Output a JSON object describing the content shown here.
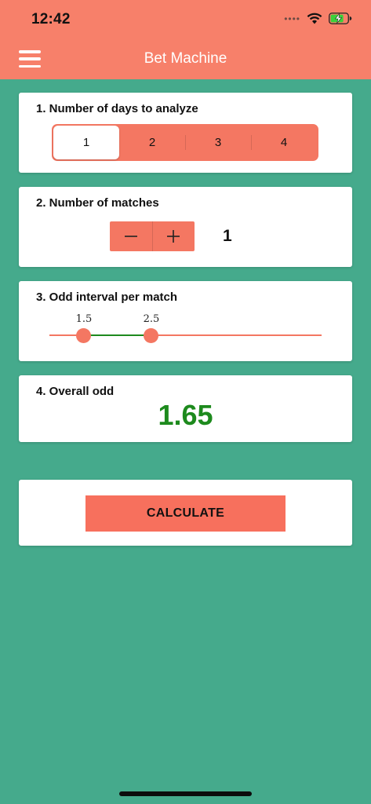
{
  "status_bar": {
    "time": "12:42",
    "signal": "••••"
  },
  "header": {
    "title": "Bet Machine"
  },
  "days": {
    "title": "1. Number of days to analyze",
    "options": [
      "1",
      "2",
      "3",
      "4"
    ],
    "selected_index": 0
  },
  "matches": {
    "title": "2. Number of matches",
    "minus_symbol": "−",
    "plus_symbol": "+",
    "value": "1"
  },
  "odd_interval": {
    "title": "3. Odd interval per match",
    "low_label": "1.5",
    "high_label": "2.5"
  },
  "overall": {
    "title": "4. Overall odd",
    "value": "1.65"
  },
  "calculate": {
    "label": "CALCULATE"
  },
  "colors": {
    "header": "#f7806a",
    "background": "#45aa8c",
    "accent": "#f47762",
    "range_fill": "#1e8a1e",
    "odd_value": "#1d8a1d"
  }
}
